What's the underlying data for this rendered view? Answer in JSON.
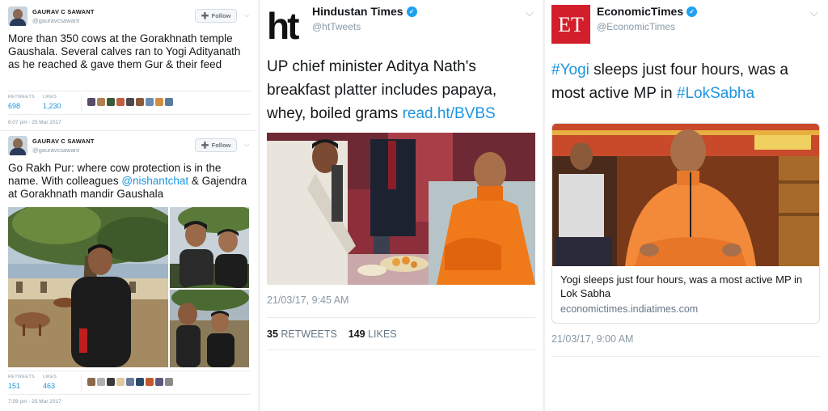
{
  "tweet1": {
    "name": "GAURAV C SAWANT",
    "handle": "@gauravcsawant",
    "follow_label": "Follow",
    "text": "More than 350 cows at the Gorakhnath temple Gaushala. Several calves ran to Yogi Adityanath as he reached & gave them Gur & their feed",
    "retweets_label": "RETWEETS",
    "retweets": "698",
    "likes_label": "LIKES",
    "likes": "1,230",
    "timestamp": "6:07 pm - 25 Mar 2017"
  },
  "tweet2": {
    "name": "GAURAV C SAWANT",
    "handle": "@gauravcsawant",
    "follow_label": "Follow",
    "text_before": "Go Rakh Pur: where cow protection is in the name. With colleagues ",
    "mention": "@nishantchat",
    "text_after": " & Gajendra at Gorakhnath mandir Gaushala",
    "retweets_label": "RETWEETS",
    "retweets": "151",
    "likes_label": "LIKES",
    "likes": "463",
    "timestamp": "7:59 pm - 25 Mar 2017"
  },
  "tweet3": {
    "logo_text": "ht",
    "name": "Hindustan Times",
    "handle": "@htTweets",
    "text": "UP chief minister Aditya Nath's breakfast platter includes papaya, whey, boiled grams ",
    "link": "read.ht/BVBS",
    "date": "21/03/17, 9:45 AM",
    "retweets": "35",
    "retweets_label": "RETWEETS",
    "likes": "149",
    "likes_label": "LIKES"
  },
  "tweet4": {
    "logo_text": "ET",
    "name": "EconomicTimes",
    "handle": "@EconomicTimes",
    "hashtag1": "#Yogi",
    "text_mid": " sleeps just four hours, was a most active MP in ",
    "hashtag2": "#LokSabha",
    "card_title": "Yogi sleeps just four hours, was a most active MP in Lok Sabha",
    "card_domain": "economictimes.indiatimes.com",
    "date": "21/03/17, 9:00 AM"
  },
  "icons": {
    "follow": "person-plus-icon",
    "dropdown": "chevron-down-icon",
    "verified": "verified-badge-icon"
  },
  "colors": {
    "link_blue": "#1b95e0",
    "verified_blue": "#1da1f2",
    "et_red": "#d31f2c",
    "saffron": "#f07a1a"
  }
}
